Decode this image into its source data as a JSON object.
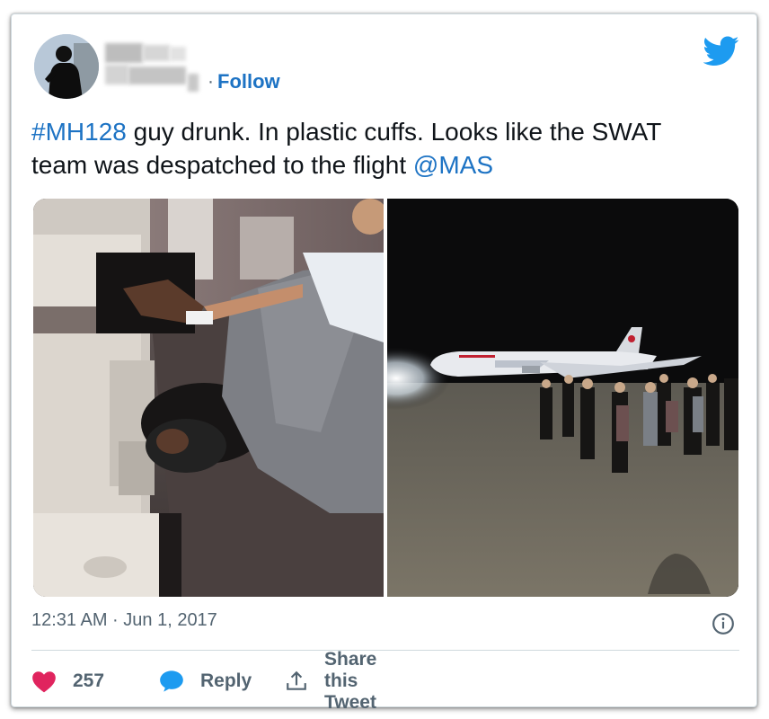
{
  "author": {
    "follow_separator": "·",
    "follow_label": "Follow",
    "avatar_icon": "user-avatar-icon"
  },
  "brand": {
    "icon": "twitter-bird-icon",
    "color": "#1d9bf0"
  },
  "tweet": {
    "hashtag": "#MH128",
    "text_part1": " guy drunk. In plastic cuffs. Looks like the SWAT team was despatched to the flight ",
    "mention": "@MAS",
    "link_color": "#1d73c4"
  },
  "media": {
    "photos": [
      {
        "icon": "photo-cabin-icon"
      },
      {
        "icon": "photo-runway-icon"
      }
    ]
  },
  "meta": {
    "timestamp": "12:31 AM · Jun 1, 2017",
    "info_icon": "info-icon"
  },
  "actions": {
    "like_count": "257",
    "like_color": "#e0245e",
    "reply_label": "Reply",
    "share_label": "Share this Tweet"
  }
}
